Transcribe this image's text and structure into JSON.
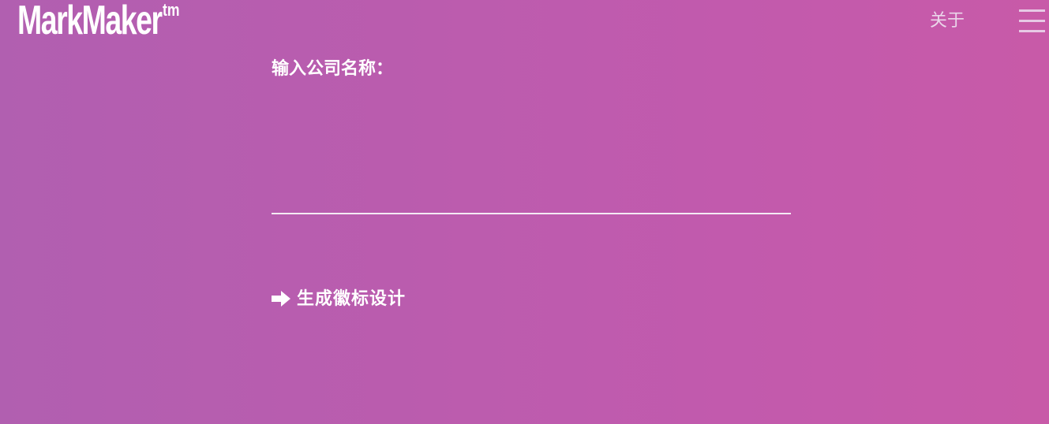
{
  "header": {
    "logo_text": "MarkMaker",
    "logo_tm": "tm",
    "about_label": "关于",
    "menu_icon": "hamburger-menu-icon"
  },
  "form": {
    "label": "输入公司名称：",
    "input_value": "",
    "input_placeholder": ""
  },
  "action": {
    "icon": "arrow-right-icon",
    "label": "生成徽标设计"
  },
  "colors": {
    "background_start": "#b15fb0",
    "background_end": "#c85aa8",
    "text": "#ffffff"
  }
}
